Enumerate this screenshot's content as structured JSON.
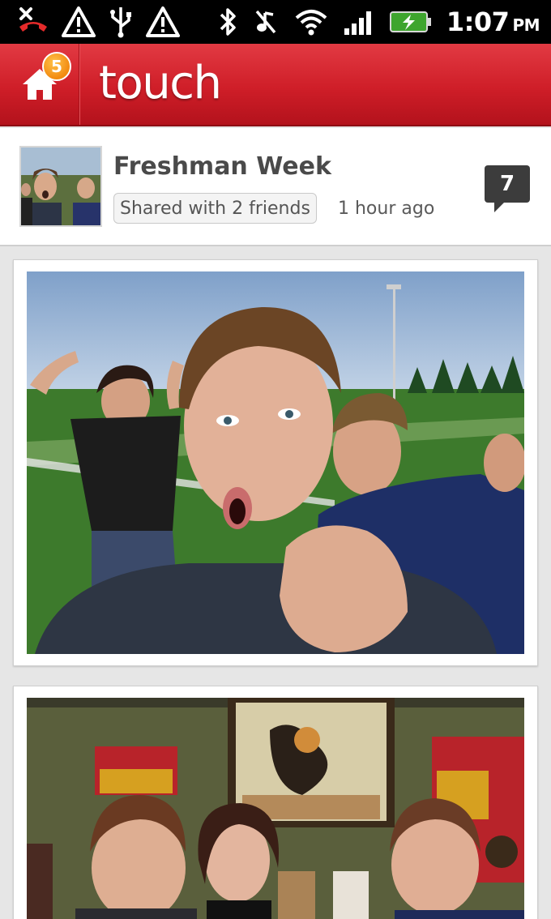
{
  "status_bar": {
    "icons": [
      "missed-call-icon",
      "warning-icon",
      "usb-icon",
      "warning-icon",
      "bluetooth-icon",
      "vibrate-icon",
      "wifi-icon",
      "signal-icon",
      "battery-charging-icon"
    ],
    "time": "1:07",
    "ampm": "PM"
  },
  "app_bar": {
    "title": "touch",
    "home_icon": "home-icon",
    "notification_count": "5",
    "accent_color": "#cf1e28"
  },
  "album": {
    "title": "Freshman Week",
    "shared_with": "Shared with 2 friends",
    "time_ago": "1 hour ago",
    "comment_count": "7"
  },
  "photos": [
    {
      "name": "photo-football-field"
    },
    {
      "name": "photo-restaurant"
    }
  ]
}
